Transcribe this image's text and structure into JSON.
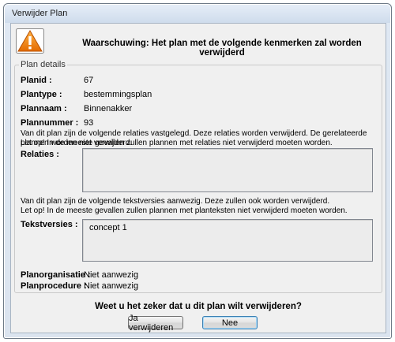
{
  "window": {
    "title": "Verwijder Plan"
  },
  "warning": {
    "text": "Waarschuwing: Het plan met de volgende kenmerken zal worden verwijderd",
    "icon": "warning-icon"
  },
  "details": {
    "group_label": "Plan details",
    "planid_label": "Planid :",
    "planid_value": "67",
    "plantype_label": "Plantype :",
    "plantype_value": "bestemmingsplan",
    "plannaam_label": "Plannaam :",
    "plannaam_value": "Binnenakker",
    "plannummer_label": "Plannummer :",
    "plannummer_value": "93"
  },
  "relaties": {
    "info_line1": "Van dit plan zijn de volgende relaties vastgelegd. Deze relaties worden verwijderd. De gerelateerde plannen worden niet verwijderd.",
    "info_line2": "Let op! In de meeste gevallen zullen plannen met relaties niet verwijderd moeten worden.",
    "label": "Relaties :",
    "items": []
  },
  "tekstversies": {
    "info_line1": "Van dit plan zijn de volgende tekstversies aanwezig. Deze zullen ook worden verwijderd.",
    "info_line2": "Let op! In de meeste gevallen zullen plannen met planteksten niet verwijderd moeten worden.",
    "label": "Tekstversies :",
    "items": [
      "concept 1"
    ]
  },
  "planorganisatie": {
    "label": "Planorganisatie :",
    "value": "Niet aanwezig"
  },
  "planprocedure": {
    "label": "Planprocedure :",
    "value": "Niet aanwezig"
  },
  "confirm": {
    "question": "Weet u het zeker dat u dit plan wilt verwijderen?",
    "yes_label": "Ja verwijderen",
    "no_label": "Nee"
  }
}
